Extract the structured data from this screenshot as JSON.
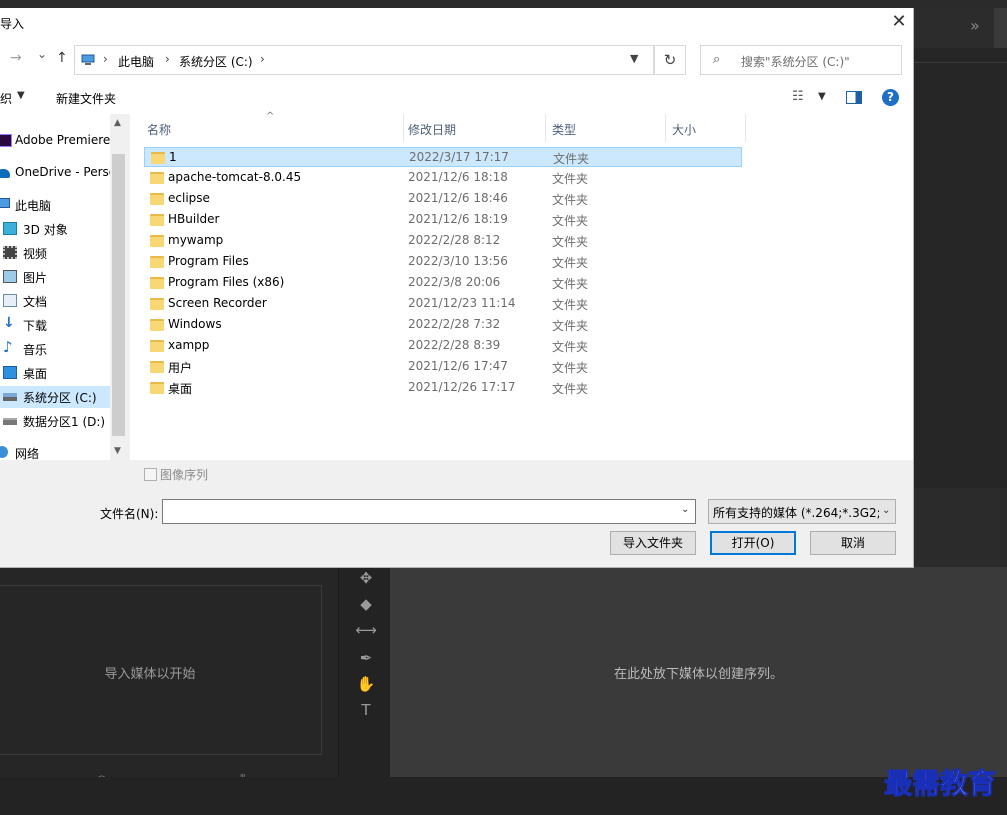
{
  "dialog": {
    "title": "导入",
    "close_glyph": "✕"
  },
  "address": {
    "back_glyph": "←",
    "forward_glyph": "→",
    "recent_glyph": "⌄",
    "up_glyph": "↑",
    "crumbs": [
      "此电脑",
      "系统分区 (C:)"
    ],
    "sep": "›",
    "search_placeholder": "搜索\"系统分区 (C:)\""
  },
  "commands": {
    "organize_label": "织",
    "new_folder_label": "新建文件夹",
    "help_glyph": "?"
  },
  "nav": {
    "items": [
      {
        "label": "Adobe Premiere",
        "icon": "premiere-icon"
      },
      {
        "label": "OneDrive - Perso",
        "icon": "cloud-icon"
      },
      {
        "label": "此电脑",
        "icon": "computer-icon"
      },
      {
        "label": "3D 对象",
        "icon": "cube-icon"
      },
      {
        "label": "视频",
        "icon": "video-icon"
      },
      {
        "label": "图片",
        "icon": "picture-icon"
      },
      {
        "label": "文档",
        "icon": "document-icon"
      },
      {
        "label": "下载",
        "icon": "download-icon"
      },
      {
        "label": "音乐",
        "icon": "music-icon"
      },
      {
        "label": "桌面",
        "icon": "desktop-icon"
      },
      {
        "label": "系统分区 (C:)",
        "icon": "drive-icon"
      },
      {
        "label": "数据分区1 (D:)",
        "icon": "drive-icon"
      },
      {
        "label": "网络",
        "icon": "network-icon"
      }
    ]
  },
  "files": {
    "columns": [
      "名称",
      "修改日期",
      "类型",
      "大小"
    ],
    "rows": [
      {
        "name": "1",
        "date": "2022/3/17 17:17",
        "type": "文件夹"
      },
      {
        "name": "apache-tomcat-8.0.45",
        "date": "2021/12/6 18:18",
        "type": "文件夹"
      },
      {
        "name": "eclipse",
        "date": "2021/12/6 18:46",
        "type": "文件夹"
      },
      {
        "name": "HBuilder",
        "date": "2021/12/6 18:19",
        "type": "文件夹"
      },
      {
        "name": "mywamp",
        "date": "2022/2/28 8:12",
        "type": "文件夹"
      },
      {
        "name": "Program Files",
        "date": "2022/3/10 13:56",
        "type": "文件夹"
      },
      {
        "name": "Program Files (x86)",
        "date": "2022/3/8 20:06",
        "type": "文件夹"
      },
      {
        "name": "Screen Recorder",
        "date": "2021/12/23 11:14",
        "type": "文件夹"
      },
      {
        "name": "Windows",
        "date": "2022/2/28 7:32",
        "type": "文件夹"
      },
      {
        "name": "xampp",
        "date": "2022/2/28 8:39",
        "type": "文件夹"
      },
      {
        "name": "用户",
        "date": "2021/12/6 17:47",
        "type": "文件夹"
      },
      {
        "name": "桌面",
        "date": "2021/12/26 17:17",
        "type": "文件夹"
      }
    ]
  },
  "footer": {
    "image_sequence_label": "图像序列",
    "filename_label": "文件名(N):",
    "filename_value": "",
    "filetype_value": "所有支持的媒体 (*.264;*.3G2;*",
    "import_folder_label": "导入文件夹",
    "open_label": "打开(O)",
    "cancel_label": "取消"
  },
  "premiere": {
    "project_empty_text": "导入媒体以开始",
    "timeline_empty_text": "在此处放下媒体以创建序列。",
    "panel_expand_glyph": "»"
  },
  "watermark": "最需教育"
}
